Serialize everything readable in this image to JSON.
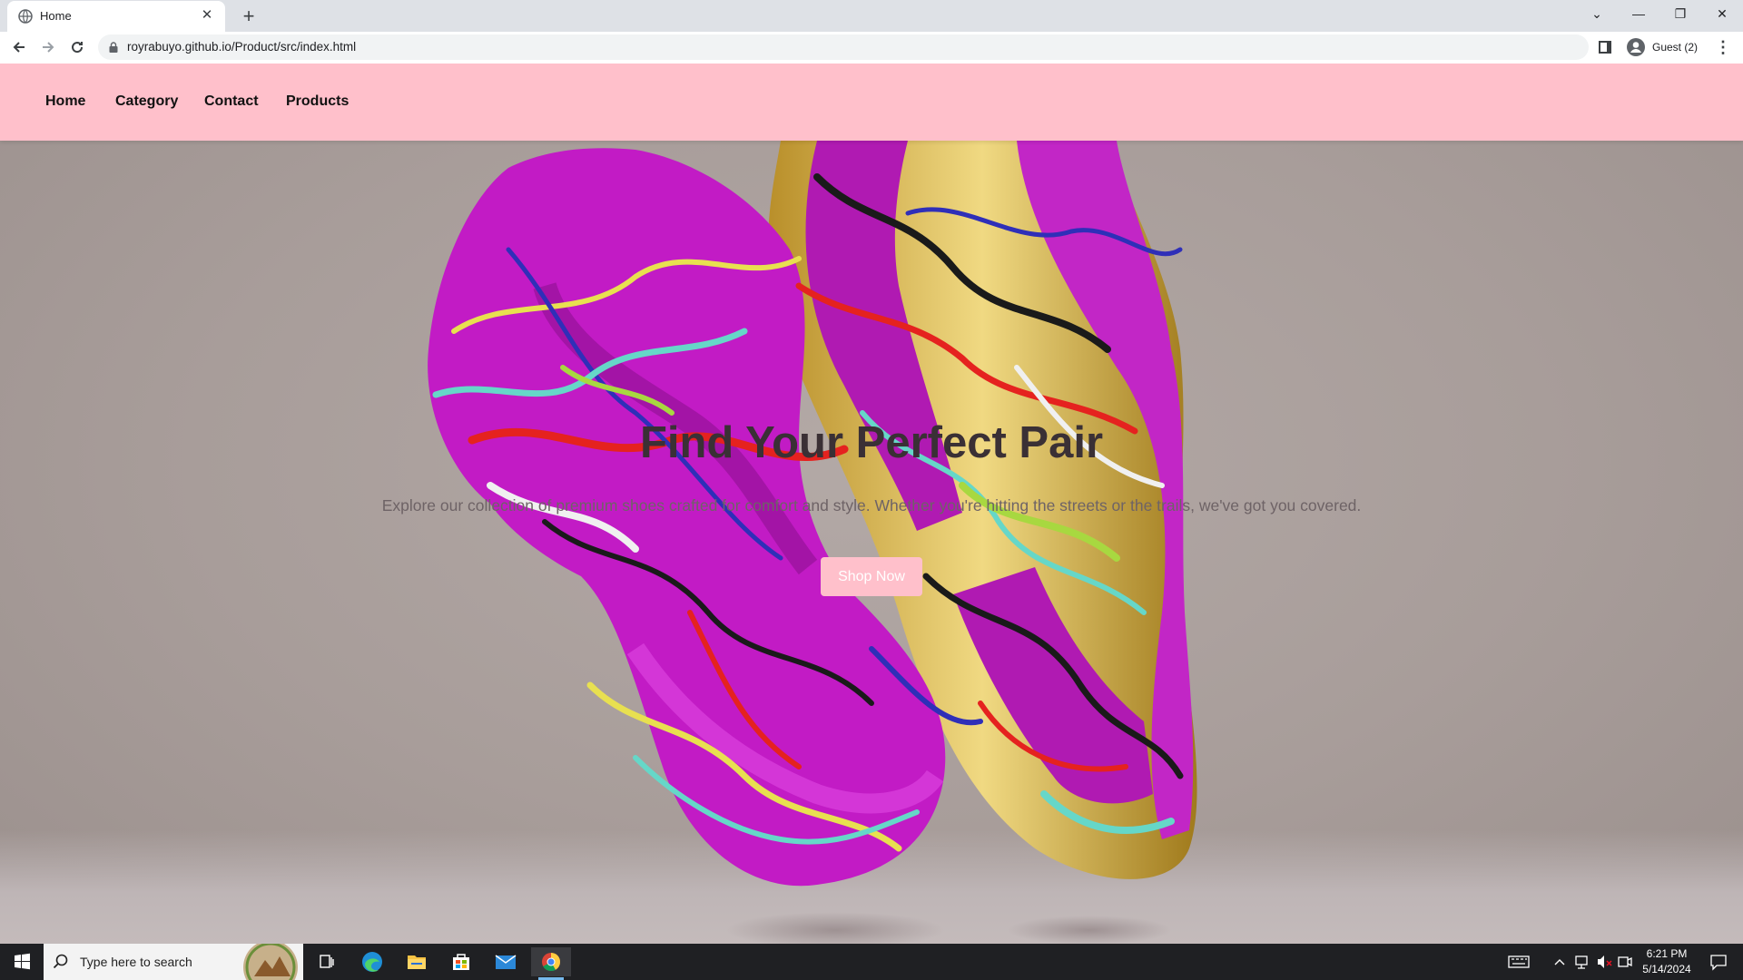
{
  "browser": {
    "tab_title": "Home",
    "tab_close": "✕",
    "new_tab": "+",
    "url": "royrabuyo.github.io/Product/src/index.html",
    "profile_label": "Guest (2)",
    "window_controls": {
      "minimize": "—",
      "restore": "❐",
      "close": "✕",
      "tab_search": "⌄"
    }
  },
  "site": {
    "nav": {
      "home": "Home",
      "category": "Category",
      "contact": "Contact",
      "products": "Products"
    },
    "hero": {
      "title": "Find Your Perfect Pair",
      "subtitle": "Explore our collection of premium shoes crafted for comfort and style. Whether you're hitting the streets or the trails, we've got you covered.",
      "cta": "Shop Now"
    },
    "colors": {
      "nav_bg": "#ffc0cb",
      "button_bg": "#ffc0cb",
      "hero_bg": "#a99d9a"
    }
  },
  "taskbar": {
    "search_placeholder": "Type here to search",
    "time": "6:21 PM",
    "date": "5/14/2024",
    "apps": [
      "task-view-icon",
      "edge-icon",
      "file-explorer-icon",
      "store-icon",
      "mail-icon",
      "chrome-icon"
    ]
  }
}
